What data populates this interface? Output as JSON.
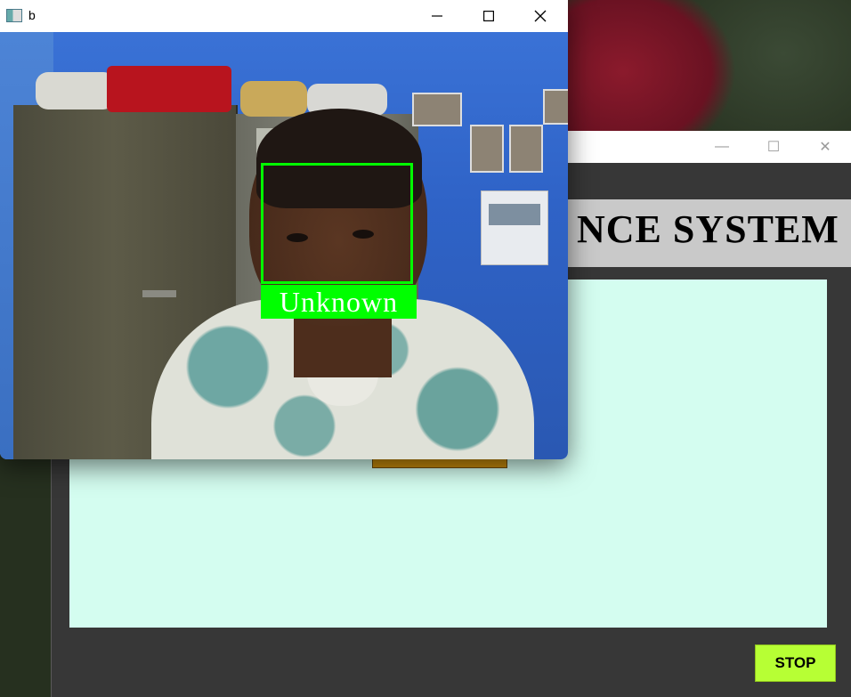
{
  "camera_window": {
    "title": "b",
    "face_label": "Unknown",
    "controls": {
      "minimize": "—",
      "maximize": "☐",
      "close": "✕"
    }
  },
  "attendance_window": {
    "heading": "NCE SYSTEM",
    "stop_label": "STOP",
    "controls": {
      "minimize": "—",
      "maximize": "☐",
      "close": "✕"
    }
  },
  "colors": {
    "face_box": "#00ff00",
    "stop_button": "#b7ff34",
    "panel": "#d4fdf0",
    "window_bg": "#373737"
  }
}
